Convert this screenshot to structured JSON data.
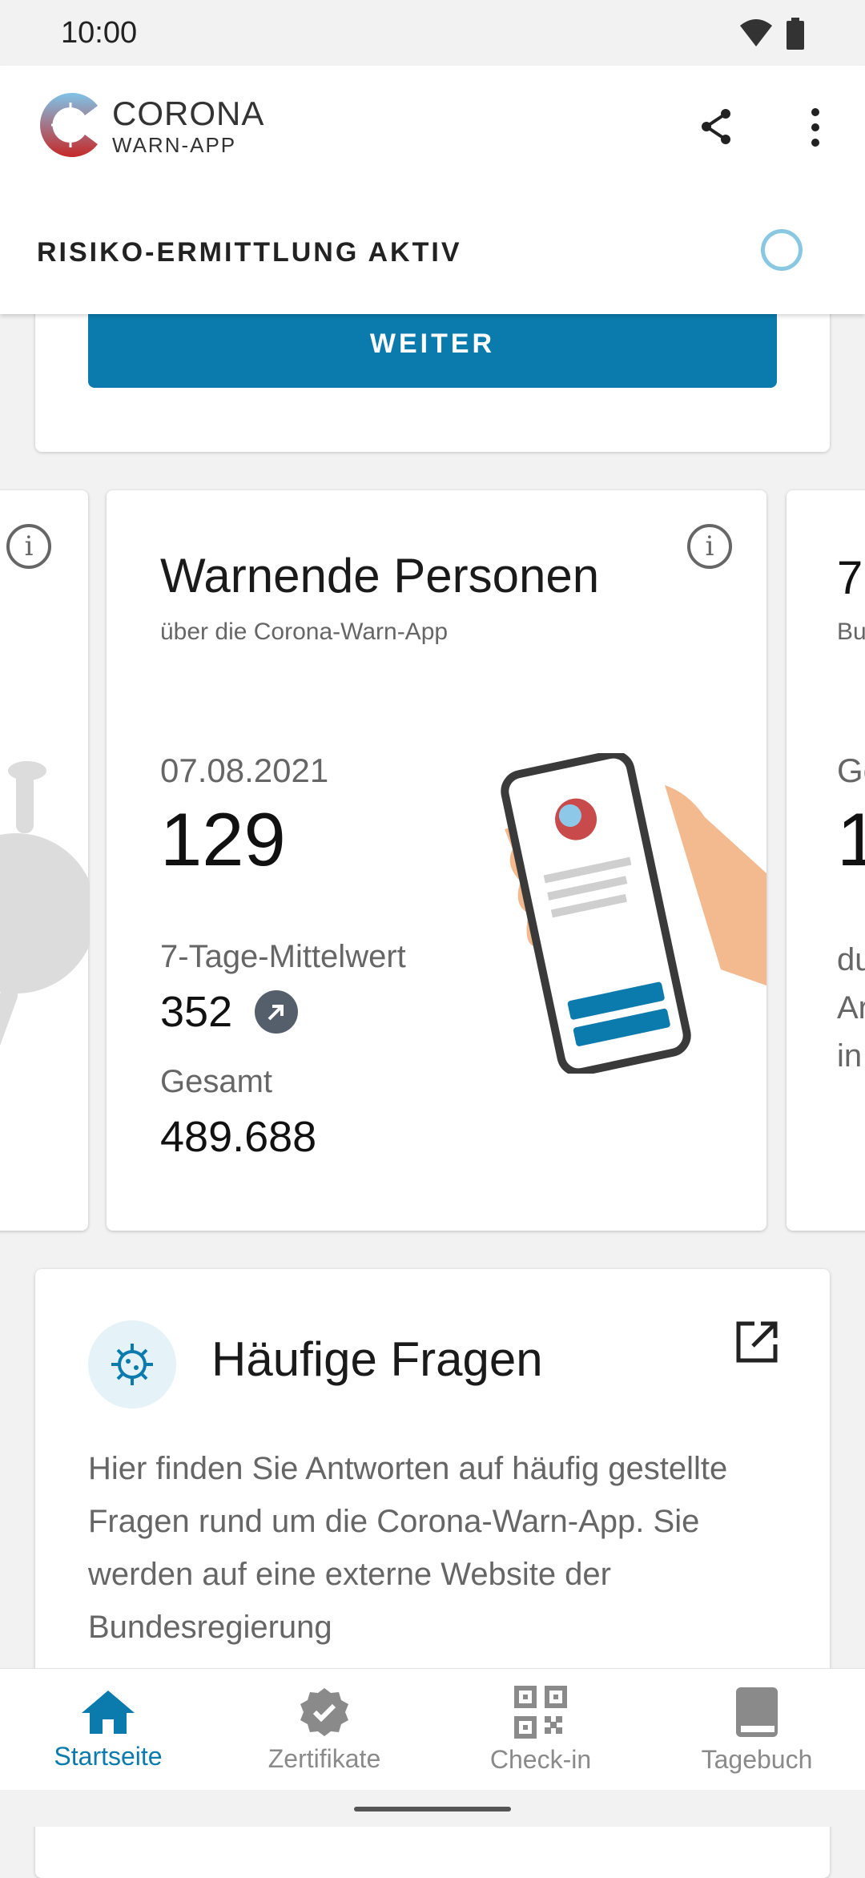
{
  "status_bar": {
    "time": "10:00"
  },
  "header": {
    "logo_title": "CORONA",
    "logo_subtitle": "WARN-APP",
    "risk_status": "RISIKO-ERMITTLUNG AKTIV"
  },
  "top_card": {
    "button_label": "WEITER"
  },
  "statistics_card": {
    "title": "Warnende Personen",
    "subtitle": "über die Corona-Warn-App",
    "date": "07.08.2021",
    "value": "129",
    "average_label": "7-Tage-Mittelwert",
    "average_value": "352",
    "total_label": "Gesamt",
    "total_value": "489.688"
  },
  "right_card_fragment": {
    "title": "7",
    "subtitle": "Bu",
    "date": "Ge",
    "value": "1",
    "line1": "du",
    "line2": "Ar",
    "line3": "in"
  },
  "faq": {
    "title": "Häufige Fragen",
    "text": "Hier finden Sie Antworten auf häufig gestellte Fragen rund um die Corona-Warn-App. Sie werden auf eine externe Website der Bundesregierung"
  },
  "bottom_nav": {
    "items": [
      {
        "label": "Startseite",
        "icon": "home-icon",
        "active": true
      },
      {
        "label": "Zertifikate",
        "icon": "certificate-icon",
        "active": false
      },
      {
        "label": "Check-in",
        "icon": "qr-code-icon",
        "active": false
      },
      {
        "label": "Tagebuch",
        "icon": "book-icon",
        "active": false
      }
    ]
  },
  "colors": {
    "accent": "#0b7bad",
    "risk_spinner": "#89c7e3",
    "logo_red": "#c62828"
  }
}
